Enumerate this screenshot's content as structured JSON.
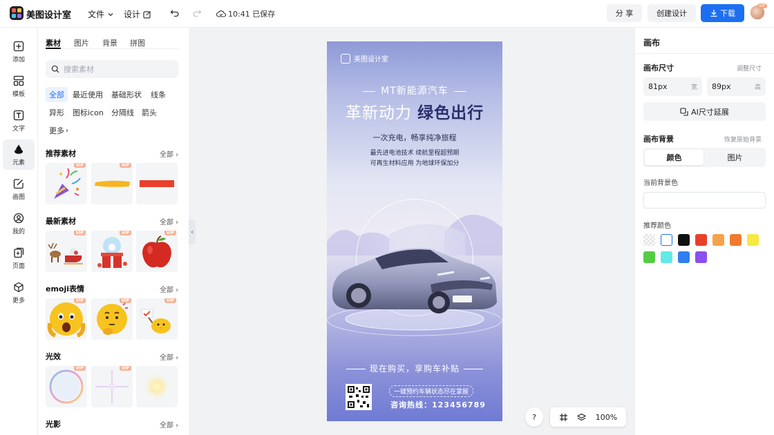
{
  "app": {
    "name": "美图设计室"
  },
  "topbar": {
    "file_menu": "文件",
    "design_menu": "设计",
    "save_status": "10:41 已保存",
    "share_label": "分 享",
    "create_label": "创建设计",
    "download_label": "下载",
    "avatar_badge": "VIP"
  },
  "leftnav": [
    {
      "label": "添加",
      "icon": "plus-square-icon"
    },
    {
      "label": "模板",
      "icon": "template-icon"
    },
    {
      "label": "文字",
      "icon": "text-icon"
    },
    {
      "label": "元素",
      "icon": "shapes-icon"
    },
    {
      "label": "画图",
      "icon": "draw-icon"
    },
    {
      "label": "我的",
      "icon": "user-icon"
    },
    {
      "label": "页面",
      "icon": "page-add-icon"
    },
    {
      "label": "更多",
      "icon": "cube-icon"
    }
  ],
  "panel": {
    "tabs": [
      "素材",
      "图片",
      "背景",
      "拼图"
    ],
    "search_placeholder": "搜索素材",
    "chips": [
      "全部",
      "最近使用",
      "基础形状",
      "线条",
      "异形",
      "图标icon",
      "分隔线",
      "箭头",
      "更多"
    ],
    "vip_badge": "VIP",
    "sections": [
      {
        "title": "推荐素材",
        "more": "全部"
      },
      {
        "title": "最新素材",
        "more": "全部"
      },
      {
        "title": "emoji表情",
        "more": "全部"
      },
      {
        "title": "光效",
        "more": "全部"
      },
      {
        "title": "光影",
        "more": "全部"
      }
    ]
  },
  "poster": {
    "brand": "美图设计室",
    "headline_small": "MT新能源汽车",
    "headline_left": "革新动力",
    "headline_right": "绿色出行",
    "sub1": "一次充电，畅享纯净旅程",
    "sub2": "最先进电池技术 续航里程超预期",
    "sub3": "可再生材料应用 为地球环保加分",
    "promo": "现在购买，享购车补贴",
    "scan_tip": "一键预约车辆状态尽在掌握",
    "hotline": "咨询热线：123456789"
  },
  "canvas_controls": {
    "help": "?",
    "zoom": "100%"
  },
  "rpanel": {
    "title": "画布",
    "size_label": "画布尺寸",
    "size_adjust": "调整尺寸",
    "width_value": "81px",
    "width_unit": "宽",
    "height_value": "89px",
    "height_unit": "高",
    "ai_expand": "AI尺寸延展",
    "bg_label": "画布背景",
    "bg_reset": "恢复原始背景",
    "seg_color": "颜色",
    "seg_image": "图片",
    "current_bg": "当前背景色",
    "recommend": "推荐颜色",
    "swatches": [
      "transparent",
      "#ffffff",
      "#111111",
      "#e8402c",
      "#f5a24b",
      "#f07a2e",
      "#f7e842",
      "#55cc44",
      "#62ebe6",
      "#2f7ff0",
      "#8a4ff0"
    ]
  }
}
